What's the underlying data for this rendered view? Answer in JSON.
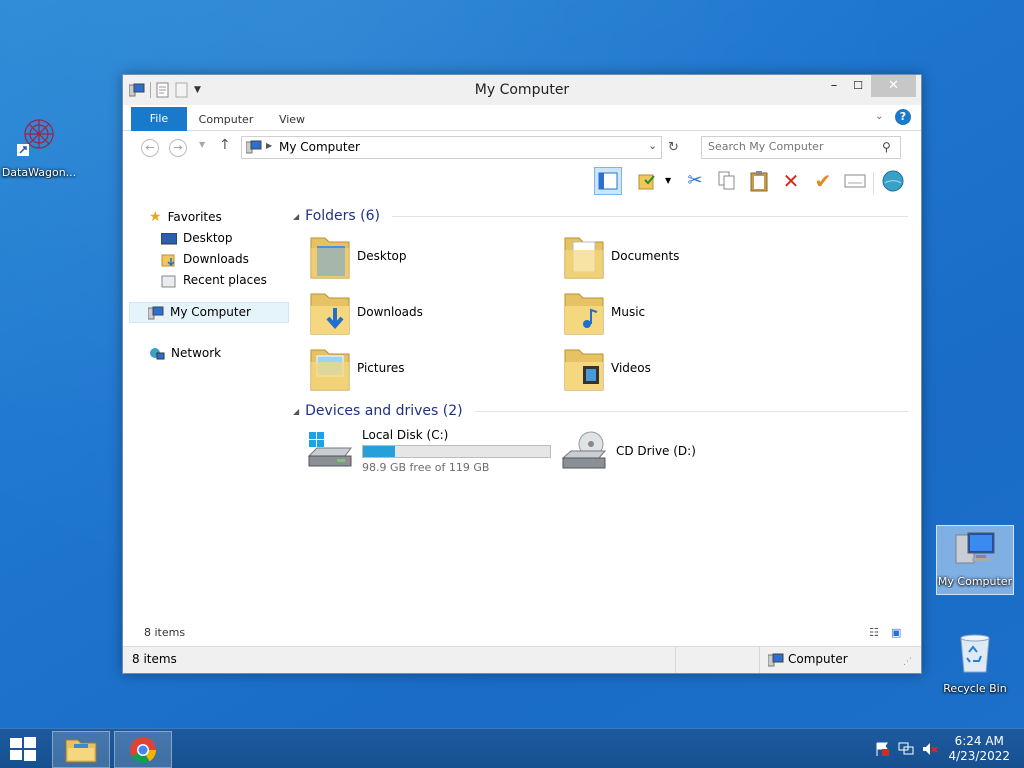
{
  "desktop": {
    "icons": [
      {
        "label": "DataWagon..."
      },
      {
        "label": "My Computer"
      },
      {
        "label": "Recycle Bin"
      }
    ]
  },
  "window": {
    "title": "My Computer",
    "controls": {
      "minimize": "–",
      "maximize": "☐",
      "close": "✕"
    },
    "ribbon": {
      "tabs": [
        "File",
        "Computer",
        "View"
      ]
    },
    "address": {
      "path": "My Computer"
    },
    "search": {
      "placeholder": "Search My Computer"
    },
    "nav": {
      "favorites": "Favorites",
      "desktop": "Desktop",
      "downloads": "Downloads",
      "recent": "Recent places",
      "computer": "My Computer",
      "network": "Network"
    },
    "folders": {
      "header": "Folders (6)",
      "items": [
        "Desktop",
        "Documents",
        "Downloads",
        "Music",
        "Pictures",
        "Videos"
      ]
    },
    "devices": {
      "header": "Devices and drives (2)",
      "items": [
        {
          "name": "Local Disk (C:)",
          "free_text": "98.9 GB free of 119 GB",
          "used_fraction": 0.17
        },
        {
          "name": "CD Drive (D:)"
        }
      ]
    },
    "item_count": "8 items",
    "statusbar": {
      "count": "8 items",
      "location": "Computer"
    }
  },
  "taskbar": {
    "clock_time": "6:24 AM",
    "clock_date": "4/23/2022"
  },
  "colors": {
    "accent": "#1979ca",
    "header_blue": "#1e3287",
    "taskbar": "#1d5a9e"
  }
}
